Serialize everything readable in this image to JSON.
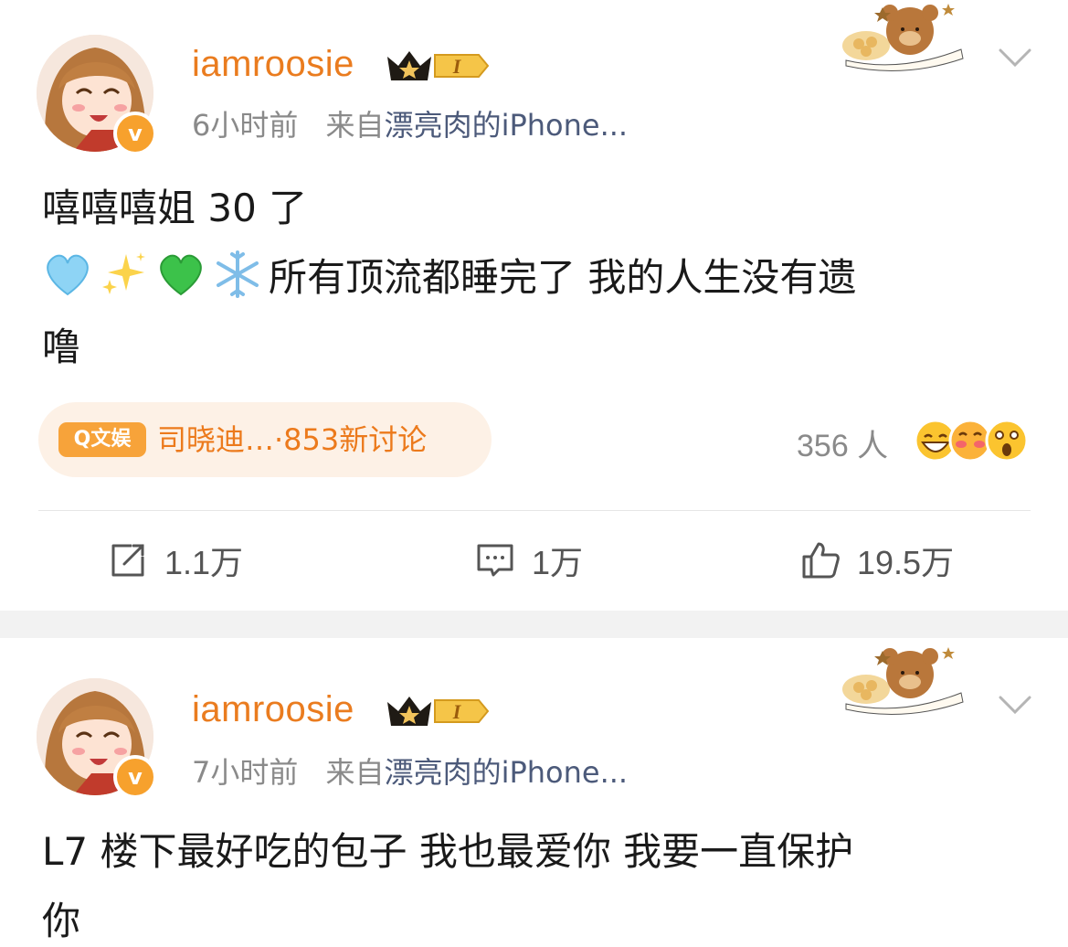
{
  "posts": [
    {
      "username": "iamroosie",
      "level_badge": "I",
      "time": "6小时前",
      "source_prefix": "来自",
      "source": "漂亮肉的iPhone...",
      "text_line1": "嘻嘻嘻姐 30 了",
      "text_line2": "所有顶流都睡完了 我的人生没有遗",
      "text_line3": "噜",
      "emojis": [
        "light-blue-heart-icon",
        "sparkles-icon",
        "green-heart-icon",
        "snowflake-icon"
      ],
      "topic_tag": "Q文娱",
      "topic_text": "司晓迪…·853新讨论",
      "reaction_count": "356 人",
      "actions": {
        "repost": "1.1万",
        "comment": "1万",
        "like": "19.5万"
      }
    },
    {
      "username": "iamroosie",
      "level_badge": "I",
      "time": "7小时前",
      "source_prefix": "来自",
      "source": "漂亮肉的iPhone...",
      "text_line1": "L7 楼下最好吃的包子 我也最爱你 我要一直保护",
      "text_line2": "你"
    }
  ],
  "colors": {
    "username": "#ea7c1f",
    "meta": "#8a8a8a",
    "source": "#4c5a7a",
    "topic_bg": "#fdf1e6",
    "topic_accent": "#ec7a1c",
    "vip_badge": "#f7a12d",
    "separator": "#f2f2f2"
  }
}
